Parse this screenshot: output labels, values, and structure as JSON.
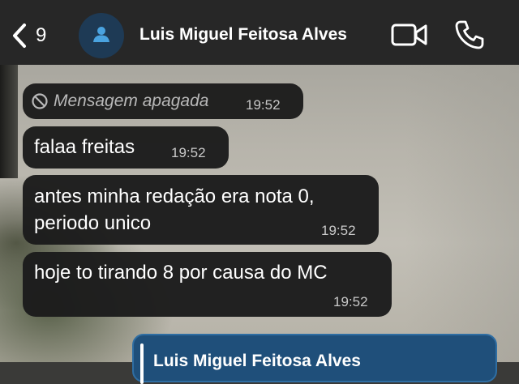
{
  "header": {
    "back_count": "9",
    "contact_name": "Luis Miguel Feitosa Alves"
  },
  "messages": [
    {
      "text": "Mensagem apagada",
      "time": "19:52",
      "deleted": true
    },
    {
      "text": "falaa freitas",
      "time": "19:52"
    },
    {
      "lines": [
        "antes minha redação era nota 0,",
        "periodo unico"
      ],
      "time": "19:52"
    },
    {
      "text": "hoje to tirando 8 por causa do MC",
      "time": "19:52"
    }
  ],
  "reply": {
    "quoted_name": "Luis Miguel Feitosa Alves"
  },
  "colors": {
    "header_bg": "#282828",
    "bubble_in": "#1c1c1c",
    "bubble_out": "#1f4f7a",
    "avatar_bg": "#1e3a55",
    "avatar_icon": "#4aa3e0"
  },
  "icons": [
    "chevron-left-icon",
    "person-icon",
    "video-camera-icon",
    "phone-icon",
    "blocked-icon"
  ]
}
